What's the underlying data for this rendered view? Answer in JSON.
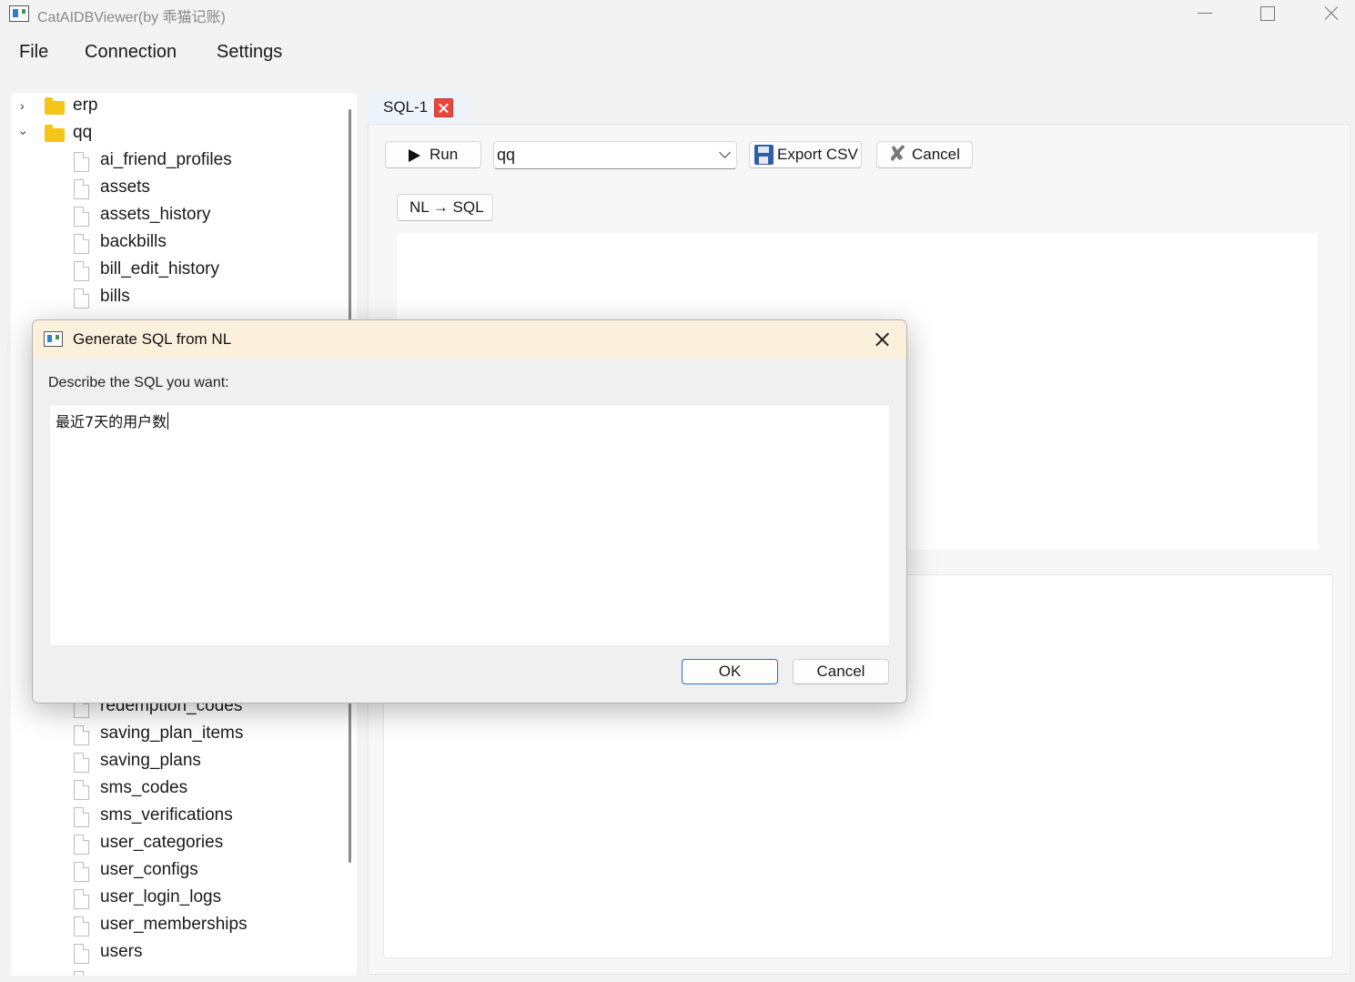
{
  "window": {
    "title": "CatAIDBViewer(by 乖猫记账)"
  },
  "menu": [
    "File",
    "Connection",
    "Settings"
  ],
  "tree": {
    "databases": [
      {
        "name": "erp",
        "expanded": false
      },
      {
        "name": "qq",
        "expanded": true
      }
    ],
    "tables_top": [
      "ai_friend_profiles",
      "assets",
      "assets_history",
      "backbills",
      "bill_edit_history",
      "bills"
    ],
    "tables_bottom": [
      "redemption_codes",
      "saving_plan_items",
      "saving_plans",
      "sms_codes",
      "sms_verifications",
      "user_categories",
      "user_configs",
      "user_login_logs",
      "user_memberships",
      "users"
    ]
  },
  "tabs": [
    {
      "label": "SQL-1",
      "active": true
    }
  ],
  "toolbar": {
    "run_label": "Run",
    "db_selected": "qq",
    "export_label": "Export CSV",
    "cancel_label": "Cancel",
    "nl_sql_label": "NL → SQL"
  },
  "dialog": {
    "title": "Generate SQL from NL",
    "prompt": "Describe the SQL you want:",
    "input_value": "最近7天的用户数",
    "ok_label": "OK",
    "cancel_label": "Cancel"
  },
  "colors": {
    "accent": "#2b6cc4",
    "dialog_title_bg": "#fbf0dc",
    "tab_close": "#e8483b",
    "folder": "#f5c518"
  }
}
